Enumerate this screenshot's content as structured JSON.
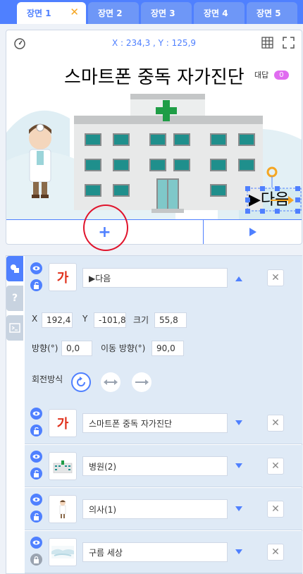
{
  "tabs": [
    {
      "label": "장면 1",
      "close": "✕"
    },
    {
      "label": "장면 2"
    },
    {
      "label": "장면 3"
    },
    {
      "label": "장면 4"
    },
    {
      "label": "장면 5"
    }
  ],
  "stage": {
    "coords": "X : 234,3 , Y : 125,9",
    "title_text": "스마트폰 중독 자가진단",
    "answer_label": "대답",
    "answer_count": "0",
    "add_label": "+"
  },
  "objects": [
    {
      "name": "▶다음",
      "thumb_text": "가",
      "expanded": true
    },
    {
      "name": "스마트폰 중독 자가진단",
      "thumb_text": "가"
    },
    {
      "name": "병원(2)",
      "thumb": "hospital-thumbnail"
    },
    {
      "name": "의사(1)",
      "thumb": "doctor-thumbnail"
    },
    {
      "name": "구름 세상",
      "thumb": "clouds-thumbnail"
    }
  ],
  "props": {
    "x_label": "X",
    "x_val": "192,4",
    "y_label": "Y",
    "y_val": "-101,8",
    "size_label": "크기",
    "size_val": "55,8",
    "dir_label": "방향(°)",
    "dir_val": "0,0",
    "move_dir_label": "이동 방향(°)",
    "move_dir_val": "90,0",
    "rotation_label": "회전방식"
  },
  "colors": {
    "accent": "#4f80ff",
    "close_orange": "#f5a623",
    "text_red": "#e0311c",
    "annotation_red": "#e0142c"
  }
}
